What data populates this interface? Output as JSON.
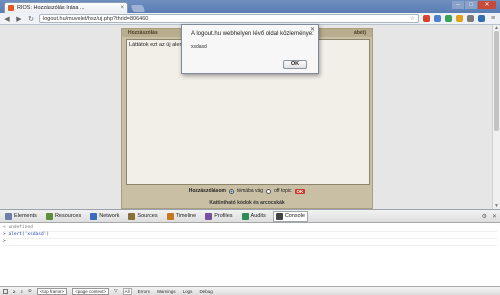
{
  "browser": {
    "tab_title": "RIOS: Hozzászólás írása ...",
    "url": "logout.hu/muvelet/hsz/uj.php?thrid=806460",
    "window_controls": [
      "–",
      "□",
      "✕"
    ]
  },
  "page": {
    "panel_header_left": "Hozzászólás",
    "panel_header_right": "ábét)",
    "textarea_value": "Láttátok ezt az új alert-po",
    "notify_label": "Hozzászólásom",
    "notify_option_1": "témába vág",
    "notify_option_2": "off topic",
    "ok_badge": "OK",
    "codes_label": "Kattintható kódok és arcocskák"
  },
  "dialog": {
    "title": "A logout.hu webhelyen lévő oldal közleménye:",
    "message": "xsdasd",
    "ok_label": "OK",
    "close": "✕"
  },
  "devtools": {
    "tabs": [
      {
        "label": "Elements",
        "color": "#6b7fa8"
      },
      {
        "label": "Resources",
        "color": "#5f8f3e"
      },
      {
        "label": "Network",
        "color": "#3a6ebd"
      },
      {
        "label": "Sources",
        "color": "#8a6d3b"
      },
      {
        "label": "Timeline",
        "color": "#c47a1c"
      },
      {
        "label": "Profiles",
        "color": "#7a4fa0"
      },
      {
        "label": "Audits",
        "color": "#2e8b57"
      },
      {
        "label": "Console",
        "color": "#444444"
      }
    ],
    "console_lines": [
      {
        "prefix": "<",
        "text": "undefined",
        "kind": "res"
      },
      {
        "prefix": ">",
        "text": "alert('xsdasd')",
        "kind": "cmd"
      },
      {
        "prefix": ">",
        "text": "",
        "kind": "prompt"
      }
    ],
    "status": {
      "frame_select": "<top frame>",
      "context_select": "<page context>",
      "filters": [
        "Errors",
        "Warnings",
        "Logs",
        "Debug"
      ]
    }
  }
}
